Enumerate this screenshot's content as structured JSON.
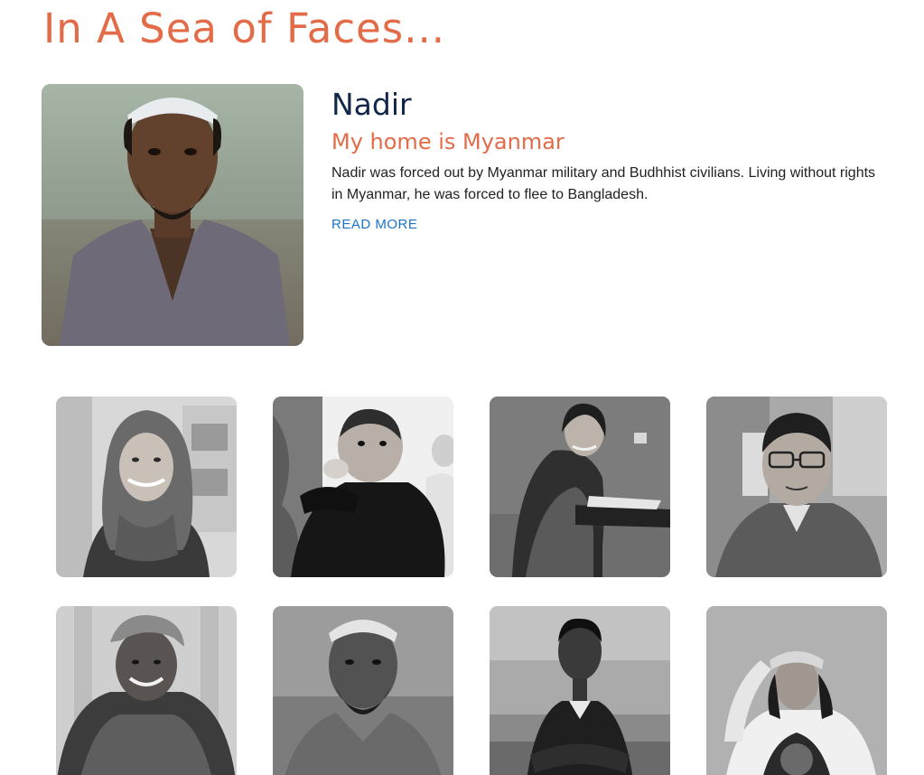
{
  "page": {
    "title": "In A Sea of Faces..."
  },
  "featured": {
    "name": "Nadir",
    "subtitle": "My home is Myanmar",
    "description": "Nadir was forced out by Myanmar military and Budhhist civilians. Living without rights in Myanmar, he was forced to flee to Bangladesh.",
    "read_more": "READ MORE"
  },
  "colors": {
    "title_accent": "#e36b47",
    "name_navy": "#11274a",
    "link_blue": "#1a73c9"
  }
}
